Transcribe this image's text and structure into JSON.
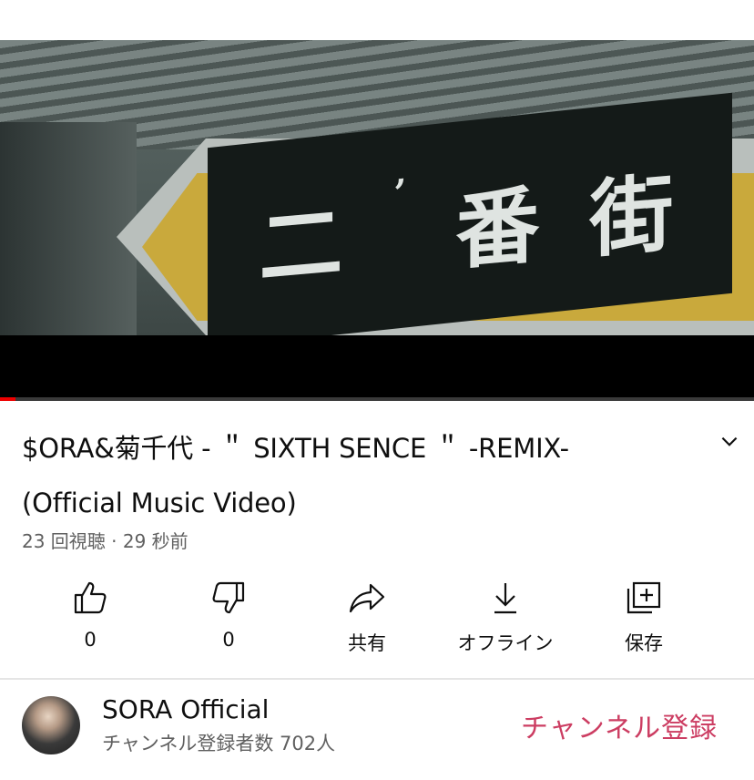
{
  "video": {
    "sign_chars": [
      "二",
      "ʼ",
      "番",
      "街"
    ],
    "progress_fraction": 0.02,
    "progress_color": "#ee0000"
  },
  "title": "$ORA&菊千代 - ＂ SIXTH SENCE ＂ -REMIX- (Official Music Video)",
  "meta": "23 回視聴 · 29 秒前",
  "actions": [
    {
      "icon": "thumbs-up-icon",
      "label": "0"
    },
    {
      "icon": "thumbs-down-icon",
      "label": "0"
    },
    {
      "icon": "share-icon",
      "label": "共有"
    },
    {
      "icon": "download-icon",
      "label": "オフライン"
    },
    {
      "icon": "save-playlist-icon",
      "label": "保存"
    }
  ],
  "channel": {
    "name": "SORA Official",
    "subscribers": "チャンネル登録者数 702人",
    "subscribe_label": "チャンネル登録",
    "subscribe_color": "#cc3d62"
  }
}
